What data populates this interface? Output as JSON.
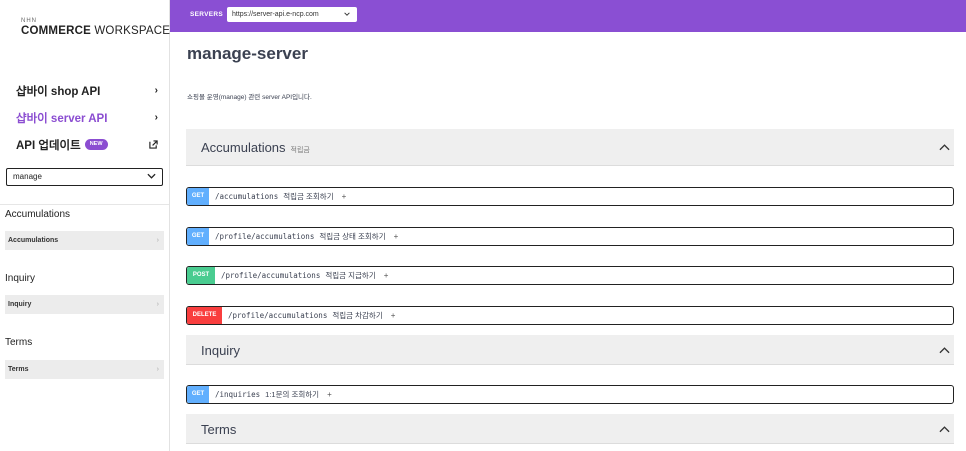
{
  "logo": {
    "top": "NHN",
    "brand": "COMMERCE",
    "suffix": "WORKSPACE"
  },
  "sidebar": {
    "nav": [
      {
        "label": "샵바이 shop API",
        "icon": "chevron-right-icon"
      },
      {
        "label": "샵바이 server API",
        "icon": "chevron-right-icon",
        "active": true
      },
      {
        "label": "API 업데이트",
        "badge": "NEW",
        "icon": "external-link-icon"
      }
    ],
    "select_value": "manage",
    "groups": [
      {
        "title": "Accumulations",
        "sub": "Accumulations"
      },
      {
        "title": "Inquiry",
        "sub": "Inquiry"
      },
      {
        "title": "Terms",
        "sub": "Terms"
      }
    ],
    "sub_arrow": "›"
  },
  "topbar": {
    "servers_label": "SERVERS",
    "server_url": "https://server-api.e-ncp.com"
  },
  "main": {
    "title": "manage-server",
    "description": "쇼핑몰 운영(manage) 관련 server API입니다.",
    "sections": [
      {
        "name": "Accumulations",
        "desc": "적립금"
      },
      {
        "name": "Inquiry",
        "desc": ""
      },
      {
        "name": "Terms",
        "desc": ""
      }
    ],
    "operations": [
      {
        "method": "GET",
        "path": "/accumulations",
        "summary": "적립금 조회하기",
        "plus": "+"
      },
      {
        "method": "GET",
        "path": "/profile/accumulations",
        "summary": "적립금 상태 조회하기",
        "plus": "+"
      },
      {
        "method": "POST",
        "path": "/profile/accumulations",
        "summary": "적립금 지급하기",
        "plus": "+"
      },
      {
        "method": "DELETE",
        "path": "/profile/accumulations",
        "summary": "적립금 차감하기",
        "plus": "+"
      },
      {
        "method": "GET",
        "path": "/inquiries",
        "summary": "1:1문의 조회하기",
        "plus": "+"
      }
    ]
  },
  "colors": {
    "topbar": "#8a4fd3",
    "accent": "#8b4dd1",
    "get": "#61affe",
    "post": "#49cc90",
    "delete": "#f93e3e"
  }
}
